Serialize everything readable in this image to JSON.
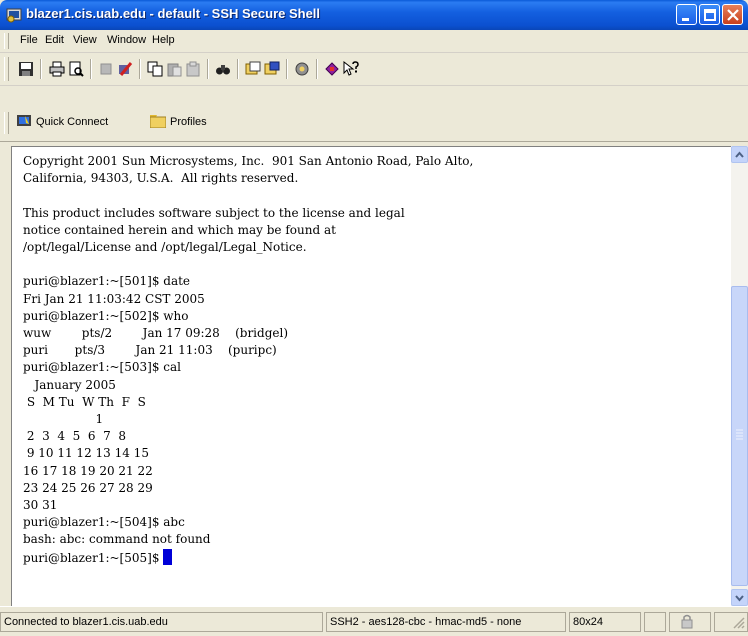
{
  "window": {
    "title": "blazer1.cis.uab.edu - default - SSH Secure Shell"
  },
  "menu": {
    "items": [
      "File",
      "Edit",
      "View",
      "Window",
      "Help"
    ]
  },
  "toolbar": {
    "icons": [
      "save-icon",
      "print-icon",
      "print-preview-icon",
      "disconnect-icon",
      "cut-icon",
      "copy-icon",
      "paste-icon",
      "paste-disabled-icon",
      "find-icon",
      "profiles-icon",
      "add-profile-icon",
      "settings-icon",
      "about-icon",
      "help-context-icon"
    ]
  },
  "quickbar": {
    "quick_connect": "Quick Connect",
    "profiles": "Profiles"
  },
  "terminal": {
    "text": "Copyright 2001 Sun Microsystems, Inc.  901 San Antonio Road, Palo Alto,\nCalifornia, 94303, U.S.A.  All rights reserved.\n\nThis product includes software subject to the license and legal\nnotice contained herein and which may be found at\n/opt/legal/License and /opt/legal/Legal_Notice.\n\npuri@blazer1:~[501]$ date\nFri Jan 21 11:03:42 CST 2005\npuri@blazer1:~[502]$ who\nwuw        pts/2        Jan 17 09:28    (bridgel)\npuri       pts/3        Jan 21 11:03    (puripc)\npuri@blazer1:~[503]$ cal\n   January 2005\n S  M Tu  W Th  F  S\n                   1\n 2  3  4  5  6  7  8\n 9 10 11 12 13 14 15\n16 17 18 19 20 21 22\n23 24 25 26 27 28 29\n30 31\npuri@blazer1:~[504]$ abc\nbash: abc: command not found\n",
    "prompt": "puri@blazer1:~[505]$ "
  },
  "statusbar": {
    "connection": "Connected to blazer1.cis.uab.edu",
    "cipher": "SSH2 - aes128-cbc - hmac-md5 - none",
    "size": "80x24"
  }
}
